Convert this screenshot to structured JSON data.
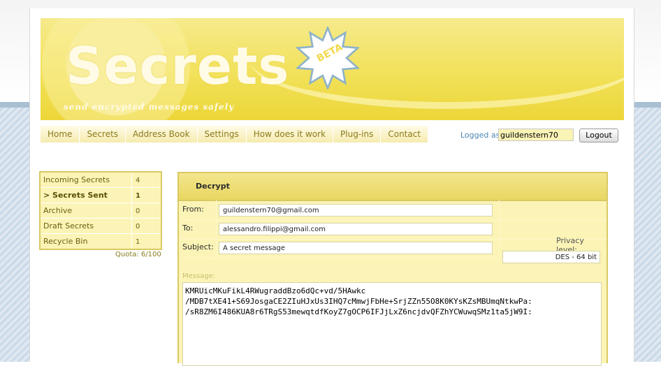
{
  "header": {
    "logo": "Secrets",
    "badge": "BETA",
    "tagline": "send encrypted messages safely"
  },
  "nav": {
    "items": [
      {
        "label": "Home"
      },
      {
        "label": "Secrets"
      },
      {
        "label": "Address Book"
      },
      {
        "label": "Settings"
      },
      {
        "label": "How does it work"
      },
      {
        "label": "Plug-ins"
      },
      {
        "label": "Contact"
      }
    ]
  },
  "session": {
    "logged_label": "Logged as:",
    "username": "guildenstern70",
    "logout_label": "Logout"
  },
  "sidebar": {
    "folders": [
      {
        "name": "Incoming Secrets",
        "count": "4"
      },
      {
        "name": "> Secrets Sent",
        "count": "1"
      },
      {
        "name": "Archive",
        "count": "0"
      },
      {
        "name": "Draft Secrets",
        "count": "0"
      },
      {
        "name": "Recycle Bin",
        "count": "1"
      }
    ],
    "quota": "Quota: 6/100"
  },
  "message": {
    "action_label": "Decrypt",
    "from_label": "From:",
    "from_value": "guildenstern70@gmail.com",
    "to_label": "To:",
    "to_value": "alessandro.filippi@gmail.com",
    "subject_label": "Subject:",
    "subject_value": "A secret message",
    "privacy_label": "Privacy level:",
    "privacy_value": "DES - 64 bit",
    "body_label": "Message:",
    "body": "KMRUicMKuFikL4RWugraddBzo6dQc+vd/5HAwkc\n/MDB7tXE41+S69JosgaCE2ZIuHJxUs3IHQ7cMmwjFbHe+SrjZZn55O8K0KYsKZsMBUmqNtkwPa:\n/sR8ZM6I486KUA8r6TRgS53mewqtdfKoyZ7gOCP6IFJjLxZ6ncjdvQFZhYCWuwqSMz1ta5jW9I:"
  },
  "colors": {
    "banner": "#f2e15a",
    "panel": "#fbf4b6",
    "border": "#d8c963",
    "link": "#4b86b4"
  }
}
